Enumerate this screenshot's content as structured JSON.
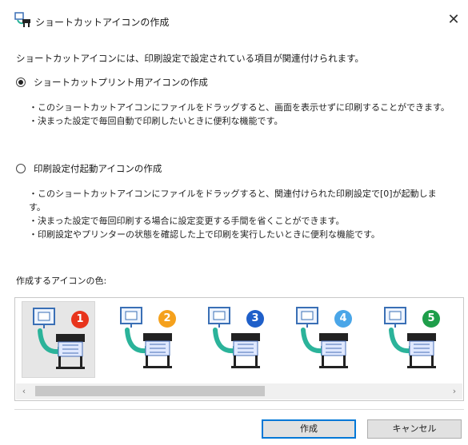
{
  "window": {
    "title": "ショートカットアイコンの作成",
    "close_glyph": "✕"
  },
  "intro": "ショートカットアイコンには、印刷設定で設定されている項目が関連付けられます。",
  "options": [
    {
      "label": "ショートカットプリント用アイコンの作成",
      "checked": true,
      "description": [
        "・このショートカットアイコンにファイルをドラッグすると、画面を表示せずに印刷することができます。",
        "・決まった設定で毎回自動で印刷したいときに便利な機能です。"
      ]
    },
    {
      "label": "印刷設定付起動アイコンの作成",
      "checked": false,
      "description": [
        "・このショートカットアイコンにファイルをドラッグすると、関連付けられた印刷設定で[0]が起動しま",
        "す。",
        "・決まった設定で毎回印刷する場合に設定変更する手間を省くことができます。",
        "・印刷設定やプリンターの状態を確認した上で印刷を実行したいときに便利な機能です。"
      ]
    }
  ],
  "icon_color_label": "作成するアイコンの色:",
  "icon_colors": [
    {
      "number": "1",
      "color": "#e8341c",
      "selected": true
    },
    {
      "number": "2",
      "color": "#f5a11c",
      "selected": false
    },
    {
      "number": "3",
      "color": "#1f5fc9",
      "selected": false
    },
    {
      "number": "4",
      "color": "#4aa6e8",
      "selected": false
    },
    {
      "number": "5",
      "color": "#1e9e4a",
      "selected": false
    }
  ],
  "buttons": {
    "create": "作成",
    "cancel": "キャンセル"
  },
  "scroll": {
    "left_arrow": "‹",
    "right_arrow": "›"
  },
  "colors": {
    "accent": "#0078d7",
    "swoosh": "#2bb39a",
    "monitor": "#3a6fb5"
  }
}
